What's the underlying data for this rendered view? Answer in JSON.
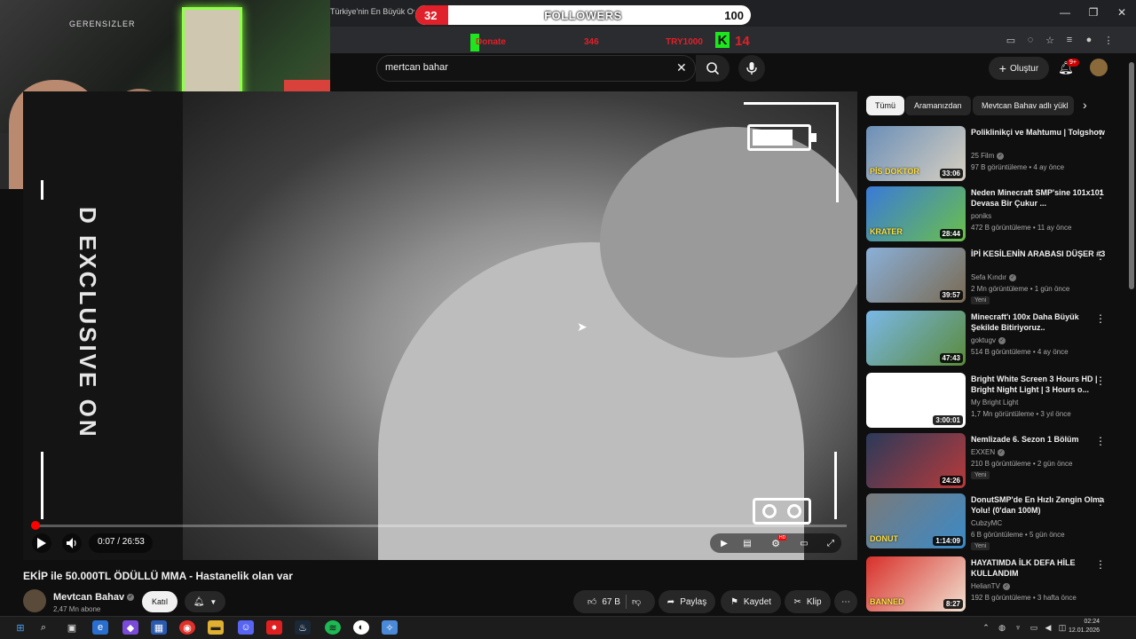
{
  "browser": {
    "tab_title": "Türkiye'nin En Büyük Oyunc... | 50.000TL ÖDÜL",
    "window_controls": [
      "—",
      "❐",
      "✕"
    ]
  },
  "overlay": {
    "followers_label": "FOLLOWERS",
    "followers_current": "32",
    "followers_goal": "100",
    "followers_progress": 0.32,
    "ticker": [
      "Donate",
      "346",
      "TRY1000"
    ],
    "kick_logo": "K",
    "kick_count": "14"
  },
  "webcam": {
    "sign_text": "GERENSIZLER"
  },
  "header": {
    "search_value": "mertcan bahar",
    "create_label": "Oluştur",
    "notification_badge": "9+"
  },
  "player": {
    "watermark_text": "D EXCLUSIVE ON",
    "time_current": "0:07",
    "time_total": "26:53",
    "time_display": "0:07 / 26:53",
    "progress": 0.004,
    "battery_level": 0.78,
    "hd_badge": "HD"
  },
  "video": {
    "title": "EKİP ile 50.000TL ÖDÜLLÜ MMA - Hastanelik olan var",
    "channel": "Mevtcan Bahav",
    "subscribers": "2,47 Mn abone",
    "join_label": "Katıl",
    "likes": "67 B",
    "share_label": "Paylaş",
    "save_label": "Kaydet",
    "clip_label": "Klip"
  },
  "chips": [
    "Tümü",
    "Aramanızdan",
    "Mevtcan Bahav adlı yükl"
  ],
  "recommendations": [
    {
      "title": "Poliklinikçi ve Mahtumu | Tolgshow",
      "channel": "25 Film",
      "verified": true,
      "meta": "97 B görüntüleme • 4 ay önce",
      "duration": "33:06",
      "new": "",
      "thumb_colors": [
        "#6b8fb8",
        "#d8d0c0"
      ],
      "thumb_text": "PİS DOKTOR"
    },
    {
      "title": "Neden Minecraft SMP'sine 101x101 Devasa Bir Çukur ...",
      "channel": "poniks",
      "verified": false,
      "meta": "472 B görüntüleme • 11 ay önce",
      "duration": "28:44",
      "new": "",
      "thumb_colors": [
        "#3a7ad8",
        "#6ac04a"
      ],
      "thumb_text": "KRATER"
    },
    {
      "title": "İPİ KESİLENİN ARABASI DÜŞER #3",
      "channel": "Sefa Kındır",
      "verified": true,
      "meta": "2 Mn görüntüleme • 1 gün önce",
      "duration": "39:57",
      "new": "Yeni",
      "thumb_colors": [
        "#8ab0d8",
        "#7a6a52"
      ],
      "thumb_text": ""
    },
    {
      "title": "Minecraft'ı 100x Daha Büyük Şekilde Bitiriyoruz..",
      "channel": "goktugv",
      "verified": true,
      "meta": "514 B görüntüleme • 4 ay önce",
      "duration": "47:43",
      "new": "",
      "thumb_colors": [
        "#7ab8e8",
        "#5a8a3a"
      ],
      "thumb_text": ""
    },
    {
      "title": "Bright White Screen 3 Hours HD | Bright Night Light | 3 Hours o...",
      "channel": "My Bright Light",
      "verified": false,
      "meta": "1,7 Mn görüntüleme • 3 yıl önce",
      "duration": "3:00:01",
      "new": "",
      "thumb_colors": [
        "#ffffff",
        "#ffffff"
      ],
      "thumb_text": ""
    },
    {
      "title": "Nemlizade 6. Sezon 1 Bölüm",
      "channel": "EXXEN",
      "verified": true,
      "meta": "210 B görüntüleme • 2 gün önce",
      "duration": "24:26",
      "new": "Yeni",
      "thumb_colors": [
        "#2a3a5a",
        "#b83a3a"
      ],
      "thumb_text": ""
    },
    {
      "title": "DonutSMP'de En Hızlı Zengin Olma Yolu! (0'dan 100M)",
      "channel": "CubzyMC",
      "verified": false,
      "meta": "6 B görüntüleme • 5 gün önce",
      "duration": "1:14:09",
      "new": "Yeni",
      "thumb_colors": [
        "#7a7a7a",
        "#3a8ac8"
      ],
      "thumb_text": "DONUT"
    },
    {
      "title": "HAYATIMDA İLK DEFA HİLE KULLANDIM",
      "channel": "HelianTV",
      "verified": true,
      "meta": "192 B görüntüleme • 3 hafta önce",
      "duration": "8:27",
      "new": "",
      "thumb_colors": [
        "#d8302a",
        "#f0e0d0"
      ],
      "thumb_text": "BANNED"
    }
  ],
  "taskbar": {
    "time": "02:24",
    "date": "12.01.2026"
  }
}
